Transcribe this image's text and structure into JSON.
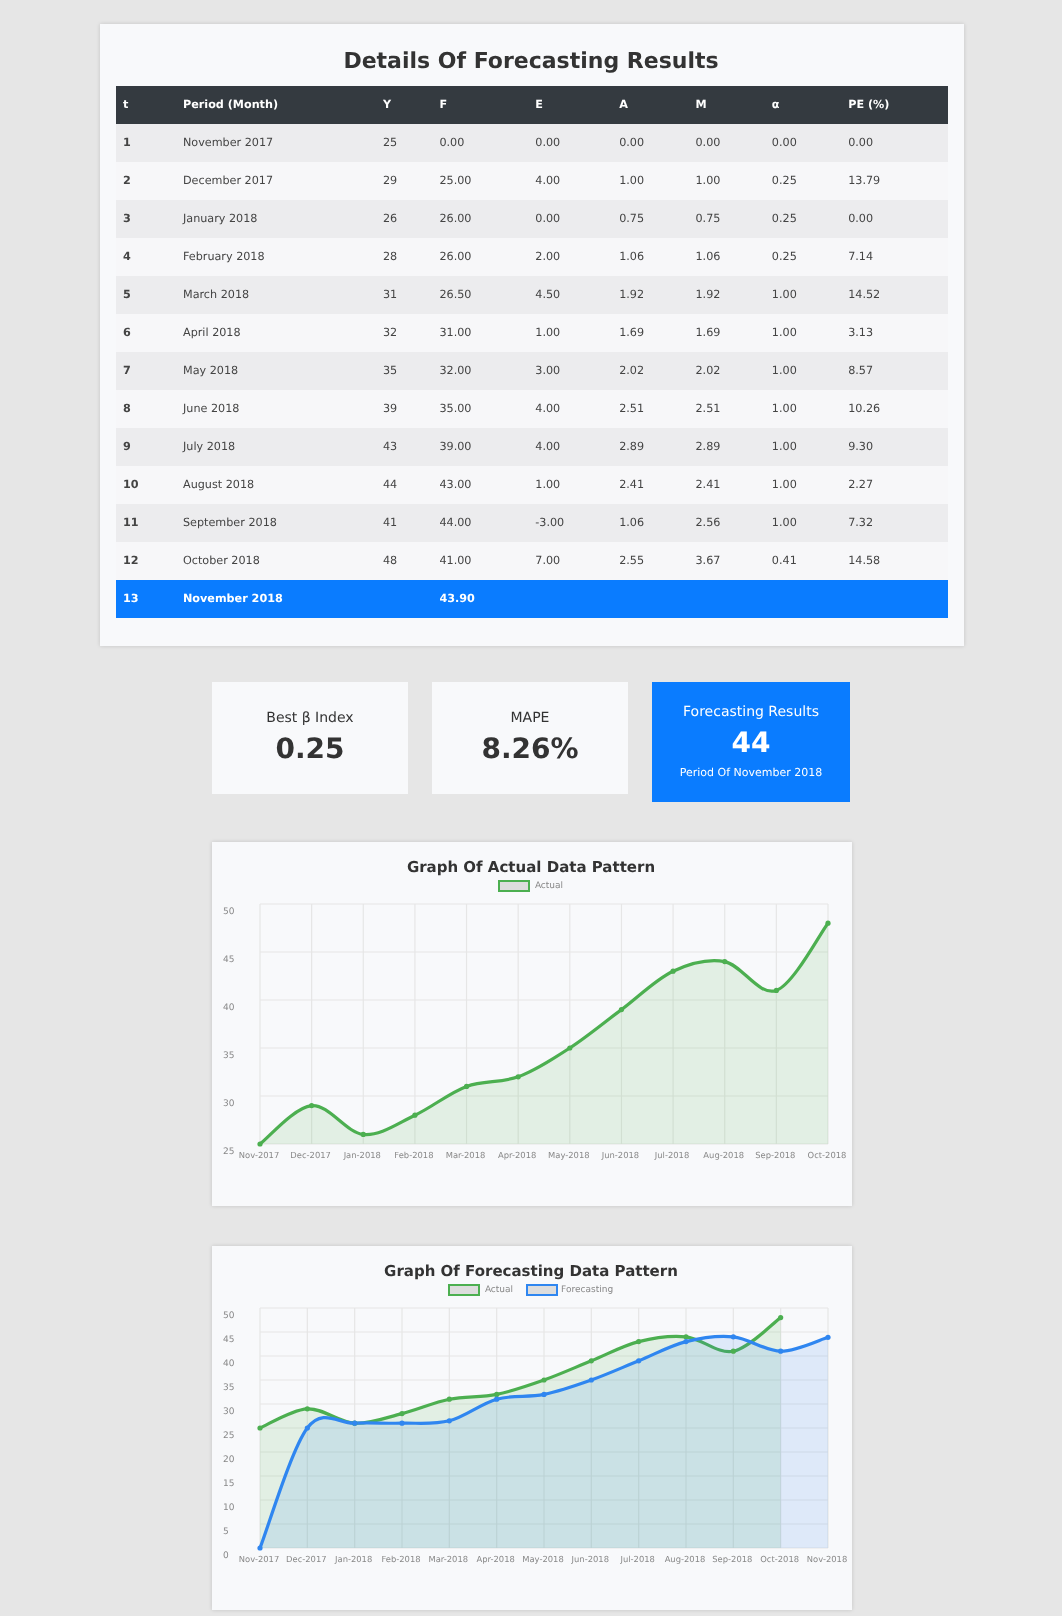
{
  "results_table": {
    "title": "Details Of Forecasting Results",
    "columns": [
      "t",
      "Period (Month)",
      "Y",
      "F",
      "E",
      "A",
      "M",
      "α",
      "PE (%)"
    ],
    "rows": [
      {
        "selected": false,
        "cells": [
          "1",
          "November 2017",
          "25",
          "0.00",
          "0.00",
          "0.00",
          "0.00",
          "0.00",
          "0.00"
        ]
      },
      {
        "selected": false,
        "cells": [
          "2",
          "December 2017",
          "29",
          "25.00",
          "4.00",
          "1.00",
          "1.00",
          "0.25",
          "13.79"
        ]
      },
      {
        "selected": false,
        "cells": [
          "3",
          "January 2018",
          "26",
          "26.00",
          "0.00",
          "0.75",
          "0.75",
          "0.25",
          "0.00"
        ]
      },
      {
        "selected": false,
        "cells": [
          "4",
          "February 2018",
          "28",
          "26.00",
          "2.00",
          "1.06",
          "1.06",
          "0.25",
          "7.14"
        ]
      },
      {
        "selected": false,
        "cells": [
          "5",
          "March 2018",
          "31",
          "26.50",
          "4.50",
          "1.92",
          "1.92",
          "1.00",
          "14.52"
        ]
      },
      {
        "selected": false,
        "cells": [
          "6",
          "April 2018",
          "32",
          "31.00",
          "1.00",
          "1.69",
          "1.69",
          "1.00",
          "3.13"
        ]
      },
      {
        "selected": false,
        "cells": [
          "7",
          "May 2018",
          "35",
          "32.00",
          "3.00",
          "2.02",
          "2.02",
          "1.00",
          "8.57"
        ]
      },
      {
        "selected": false,
        "cells": [
          "8",
          "June 2018",
          "39",
          "35.00",
          "4.00",
          "2.51",
          "2.51",
          "1.00",
          "10.26"
        ]
      },
      {
        "selected": false,
        "cells": [
          "9",
          "July 2018",
          "43",
          "39.00",
          "4.00",
          "2.89",
          "2.89",
          "1.00",
          "9.30"
        ]
      },
      {
        "selected": false,
        "cells": [
          "10",
          "August 2018",
          "44",
          "43.00",
          "1.00",
          "2.41",
          "2.41",
          "1.00",
          "2.27"
        ]
      },
      {
        "selected": false,
        "cells": [
          "11",
          "September 2018",
          "41",
          "44.00",
          "-3.00",
          "1.06",
          "2.56",
          "1.00",
          "7.32"
        ]
      },
      {
        "selected": false,
        "cells": [
          "12",
          "October 2018",
          "48",
          "41.00",
          "7.00",
          "2.55",
          "3.67",
          "0.41",
          "14.58"
        ]
      },
      {
        "selected": true,
        "cells": [
          "13",
          "November 2018",
          null,
          "43.90",
          null,
          null,
          null,
          null,
          null
        ]
      }
    ]
  },
  "stat_cards": [
    {
      "kind": "plain",
      "label": "Best β Index",
      "value": "0.25"
    },
    {
      "kind": "plain",
      "label": "MAPE",
      "value": "8.26%"
    },
    {
      "kind": "highlight",
      "label": "Forecasting Results",
      "value": "44",
      "caption": "Period Of November 2018"
    }
  ],
  "charts": [
    {
      "chart_data": {
        "type": "area",
        "title": "Graph Of Actual Data Pattern",
        "categories": [
          "Nov-2017",
          "Dec-2017",
          "Jan-2018",
          "Feb-2018",
          "Mar-2018",
          "Apr-2018",
          "May-2018",
          "Jun-2018",
          "Jul-2018",
          "Aug-2018",
          "Sep-2018",
          "Oct-2018"
        ],
        "series": [
          {
            "name": "Actual",
            "color": "#4caf50",
            "values": [
              25,
              29,
              26,
              28,
              31,
              32,
              35,
              39,
              43,
              44,
              41,
              48
            ]
          }
        ],
        "ylim": [
          25,
          50
        ],
        "yticks": [
          25,
          30,
          35,
          40,
          45,
          50
        ],
        "grid": true
      }
    },
    {
      "chart_data": {
        "type": "area",
        "title": "Graph Of Forecasting Data Pattern",
        "categories": [
          "Nov-2017",
          "Dec-2017",
          "Jan-2018",
          "Feb-2018",
          "Mar-2018",
          "Apr-2018",
          "May-2018",
          "Jun-2018",
          "Jul-2018",
          "Aug-2018",
          "Sep-2018",
          "Oct-2018",
          "Nov-2018"
        ],
        "series": [
          {
            "name": "Actual",
            "color": "#4caf50",
            "values": [
              25,
              29,
              26,
              28,
              31,
              32,
              35,
              39,
              43,
              44,
              41,
              48,
              null
            ]
          },
          {
            "name": "Forecasting",
            "color": "#2f86f0",
            "values": [
              0,
              25,
              26,
              26,
              26.5,
              31,
              32,
              35,
              39,
              43,
              44,
              41,
              43.9
            ]
          }
        ],
        "ylim": [
          0,
          50
        ],
        "yticks": [
          0,
          5,
          10,
          15,
          20,
          25,
          30,
          35,
          40,
          45,
          50
        ],
        "grid": true
      }
    }
  ]
}
